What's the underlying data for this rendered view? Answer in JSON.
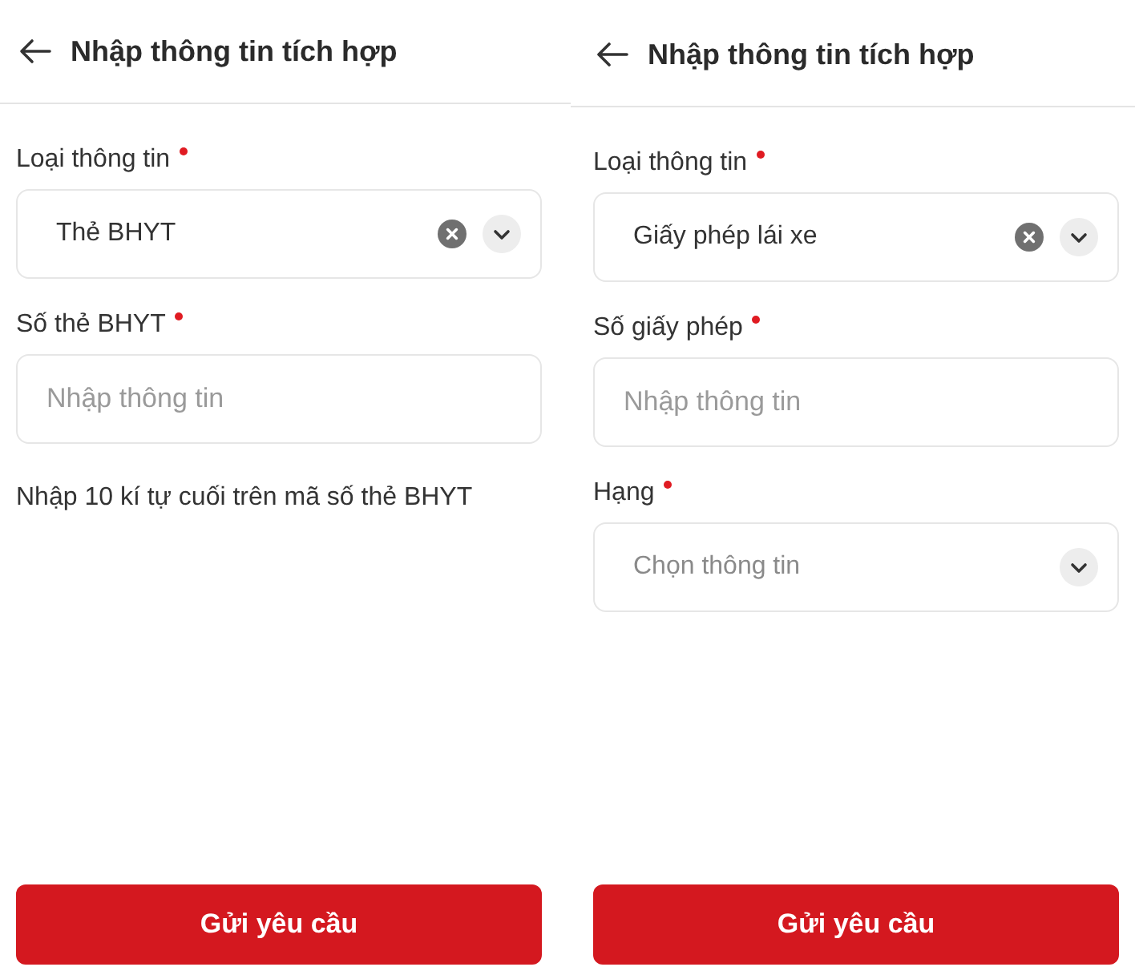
{
  "screens": [
    {
      "title": "Nhập thông tin tích hợp",
      "fields": [
        {
          "kind": "select",
          "label": "Loại thông tin",
          "required": true,
          "value": "Thẻ BHYT"
        },
        {
          "kind": "input",
          "label": "Số thẻ BHYT",
          "required": true,
          "placeholder": "Nhập thông tin"
        },
        {
          "kind": "note",
          "text": "Nhập 10 kí tự cuối trên mã số thẻ BHYT"
        }
      ],
      "submit": "Gửi yêu cầu"
    },
    {
      "title": "Nhập thông tin tích hợp",
      "fields": [
        {
          "kind": "select",
          "label": "Loại thông tin",
          "required": true,
          "value": "Giấy phép lái xe"
        },
        {
          "kind": "input",
          "label": "Số giấy phép",
          "required": true,
          "placeholder": "Nhập thông tin"
        },
        {
          "kind": "select",
          "label": "Hạng",
          "required": true,
          "placeholder": "Chọn thông tin"
        }
      ],
      "submit": "Gửi yêu cầu"
    }
  ]
}
